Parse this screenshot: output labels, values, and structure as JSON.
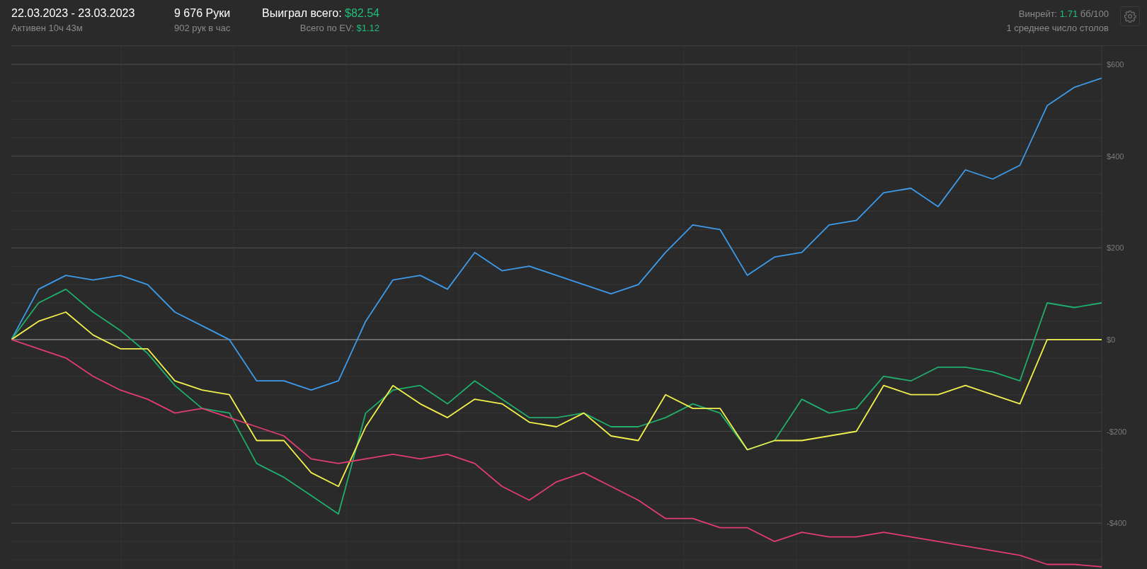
{
  "header": {
    "date_range": "22.03.2023 - 23.03.2023",
    "active": "Активен 10ч 43м",
    "hands": "9 676 Руки",
    "hands_per_hour": "902 рук в час",
    "won_label": "Выиграл всего:",
    "won_value": "$82.54",
    "ev_label": "Всего по EV:",
    "ev_value": "$1.12",
    "winrate_label": "Винрейт:",
    "winrate_value": "1.71",
    "winrate_unit": "бб/100",
    "avg_tables": "1 среднее число столов"
  },
  "chart_data": {
    "type": "line",
    "grid": true,
    "ylim": [
      -500,
      640
    ],
    "yticks": [
      {
        "value": 600,
        "label": "$600"
      },
      {
        "value": 400,
        "label": "$400"
      },
      {
        "value": 200,
        "label": "$200"
      },
      {
        "value": 0,
        "label": "$0"
      },
      {
        "value": -200,
        "label": "-$200"
      },
      {
        "value": -400,
        "label": "-$400"
      }
    ],
    "series": [
      {
        "color": "#3d9be9",
        "values": [
          0,
          110,
          140,
          130,
          140,
          120,
          60,
          30,
          0,
          -90,
          -90,
          -110,
          -90,
          40,
          130,
          140,
          110,
          190,
          150,
          160,
          140,
          120,
          100,
          120,
          190,
          250,
          240,
          140,
          180,
          190,
          250,
          260,
          320,
          330,
          290,
          370,
          350,
          380,
          510,
          550,
          570
        ]
      },
      {
        "color": "#1fae6b",
        "values": [
          0,
          80,
          110,
          60,
          20,
          -30,
          -100,
          -150,
          -160,
          -270,
          -300,
          -340,
          -380,
          -160,
          -110,
          -100,
          -140,
          -90,
          -130,
          -170,
          -170,
          -160,
          -190,
          -190,
          -170,
          -140,
          -160,
          -240,
          -220,
          -130,
          -160,
          -150,
          -80,
          -90,
          -60,
          -60,
          -70,
          -90,
          80,
          70,
          80
        ]
      },
      {
        "color": "#f1f04c",
        "values": [
          0,
          40,
          60,
          10,
          -20,
          -20,
          -90,
          -110,
          -120,
          -220,
          -220,
          -290,
          -320,
          -190,
          -100,
          -140,
          -170,
          -130,
          -140,
          -180,
          -190,
          -160,
          -210,
          -220,
          -120,
          -150,
          -150,
          -240,
          -220,
          -220,
          -210,
          -200,
          -100,
          -120,
          -120,
          -100,
          -120,
          -140,
          0,
          0,
          0
        ]
      },
      {
        "color": "#e23c72",
        "values": [
          0,
          -20,
          -40,
          -80,
          -110,
          -130,
          -160,
          -150,
          -170,
          -190,
          -210,
          -260,
          -270,
          -260,
          -250,
          -260,
          -250,
          -270,
          -320,
          -350,
          -310,
          -290,
          -320,
          -350,
          -390,
          -390,
          -410,
          -410,
          -440,
          -420,
          -430,
          -430,
          -420,
          -430,
          -440,
          -450,
          -460,
          -470,
          -490,
          -490,
          -495
        ]
      }
    ]
  }
}
